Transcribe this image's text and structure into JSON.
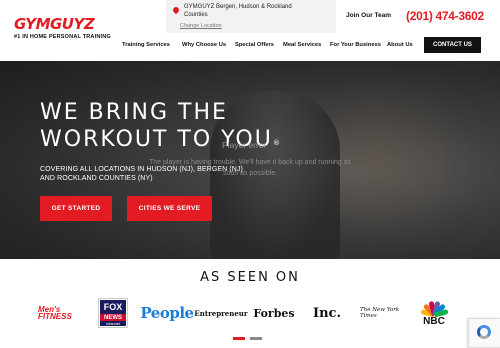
{
  "header": {
    "logo_text": "GYMGUYZ",
    "logo_tagline": "#1 IN HOME PERSONAL TRAINING",
    "location_text": "GYMGUYZ Bergen, Hudson & Rockland Counties",
    "change_location": "Change Location",
    "join_team": "Join Our Team",
    "phone": "(201) 474-3602",
    "contact_button": "CONTACT US",
    "nav": [
      "Training Services",
      "Why Choose Us",
      "Special Offers",
      "Meal Services",
      "For Your Business",
      "About Us"
    ]
  },
  "hero": {
    "title_line1": "WE BRING THE",
    "title_line2": "WORKOUT TO YOU",
    "registered": "®",
    "subtitle": "COVERING ALL LOCATIONS IN HUDSON (NJ), BERGEN (NJ) AND ROCKLAND COUNTIES (NY)",
    "player_error_title": "Player error",
    "player_error_message": "The player is having trouble. We'll have it back up and running as soon as possible.",
    "primary_button": "GET STARTED",
    "secondary_button": "CITIES WE SERVE"
  },
  "press": {
    "title": "AS SEEN ON",
    "logos": {
      "mens_fitness_top": "Men's",
      "mens_fitness_bottom": "FITNESS",
      "fox_top": "FOX",
      "fox_mid": "NEWS",
      "fox_bottom": "channel",
      "people": "People",
      "entrepreneur": "Entrepreneur",
      "forbes": "Forbes",
      "inc": "Inc.",
      "nyt": "The New York Times",
      "nbc": "NBC"
    }
  },
  "colors": {
    "brand_red": "#e31b23",
    "nav_dark": "#111111",
    "carousel_active": "#e31b23",
    "carousel_inactive": "#888888"
  },
  "carousel": {
    "pages": 2,
    "active": 1
  }
}
